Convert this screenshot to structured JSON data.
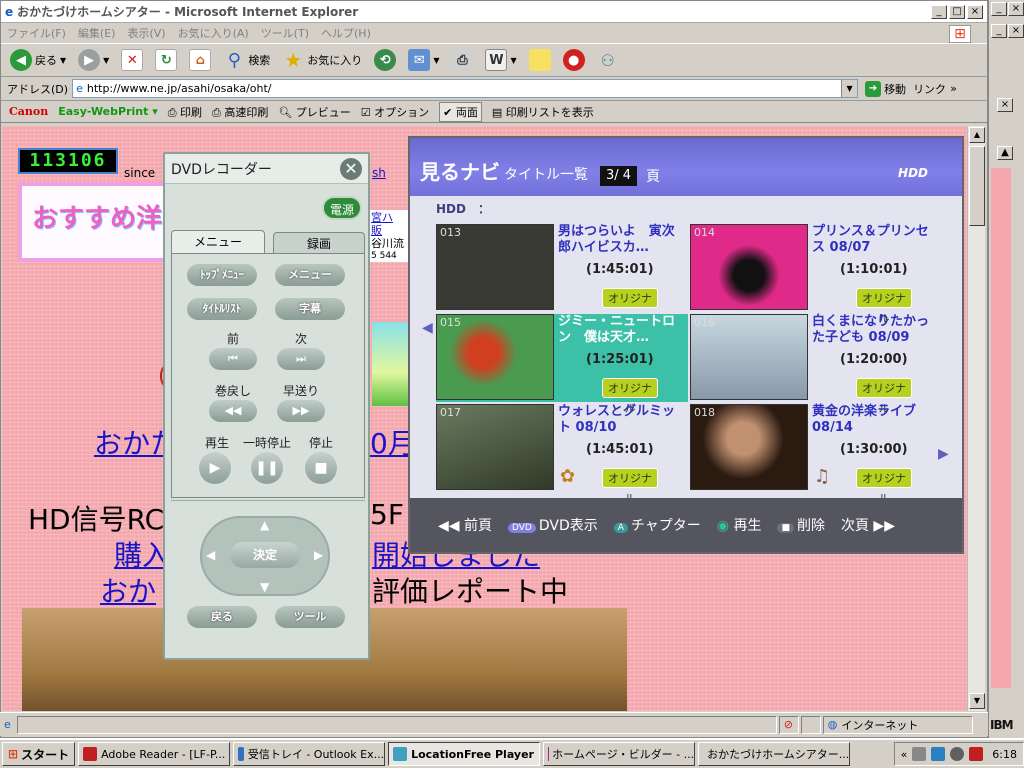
{
  "window": {
    "title": "おかたづけホームシアター - Microsoft Internet Explorer",
    "controls": [
      "_",
      "□",
      "×"
    ]
  },
  "menu": [
    "ファイル(F)",
    "編集(E)",
    "表示(V)",
    "お気に入り(A)",
    "ツール(T)",
    "ヘルプ(H)"
  ],
  "toolbar": {
    "back": "戻る",
    "search": "検索",
    "favorites": "お気に入り"
  },
  "address": {
    "label": "アドレス(D)",
    "url": "http://www.ne.jp/asahi/osaka/oht/",
    "go": "移動",
    "links": "リンク"
  },
  "printbar": {
    "canon": "Canon",
    "easy": "Easy-WebPrint",
    "print": "印刷",
    "fastprint": "高速印刷",
    "preview": "プレビュー",
    "option": "オプション",
    "both": "両面",
    "list": "印刷リストを表示"
  },
  "page": {
    "counter": "113106",
    "since": "since",
    "banner": "おすすめ洋",
    "side_text": [
      "sh",
      "宮ハ",
      "販",
      "谷川流",
      "5 544"
    ],
    "link_line1": "おかた",
    "link_line1_end": "0月",
    "hd_line": "HD信号RC",
    "hd_line_end": "5F",
    "link_buy": "購入",
    "link_buy_end": "開始しました",
    "review_prefix": "おか",
    "review_text": "評価レポート中"
  },
  "dvd": {
    "title": "DVDレコーダー",
    "power": "電源",
    "tabs": [
      "メニュー",
      "録画"
    ],
    "topmenu": "ﾄｯﾌﾟﾒﾆｭｰ",
    "menu": "メニュー",
    "titlelist": "ﾀｲﾄﾙﾘｽﾄ",
    "subtitle": "字幕",
    "prev": "前",
    "next": "次",
    "rewind": "巻戻し",
    "ffwd": "早送り",
    "play": "再生",
    "pause": "一時停止",
    "stop": "停止",
    "ok": "決定",
    "back": "戻る",
    "tool": "ツール"
  },
  "tv": {
    "logo": "見るナビ",
    "title": "タイトル一覧",
    "page": "3/ 4",
    "page_unit": "頁",
    "hdd": "HDD",
    "subheader": "HDD　：",
    "original": "オリジナル",
    "items": [
      {
        "num": "013",
        "title": "男はつらいよ　寅次郎ハイビスカ…",
        "dur": "(1:45:01)",
        "thumb": "#3a3a34"
      },
      {
        "num": "014",
        "title": "プリンス＆プリンセス 08/07",
        "dur": "(1:10:01)",
        "thumb": "#e02a8a"
      },
      {
        "num": "015",
        "title": "ジミー・ニュートロン　僕は天才…",
        "dur": "(1:25:01)",
        "thumb": "#4a9a50"
      },
      {
        "num": "016",
        "title": "白くまになりたかった子ども 08/09",
        "dur": "(1:20:00)",
        "thumb": "#c8d8e0"
      },
      {
        "num": "017",
        "title": "ウォレスとグルミット 08/10",
        "dur": "(1:45:01)",
        "thumb": "#506048"
      },
      {
        "num": "018",
        "title": "黄金の洋楽ライブ 08/14",
        "dur": "(1:30:00)",
        "thumb": "#3a2a20"
      }
    ],
    "footer": {
      "prev": "前頁",
      "dvd": "DVD表示",
      "chapter": "チャプター",
      "play": "再生",
      "delete": "削除",
      "next": "次頁"
    }
  },
  "status": {
    "zone": "インターネット"
  },
  "taskbar": {
    "start": "スタート",
    "tasks": [
      "Adobe Reader - [LF-P...",
      "受信トレイ - Outlook Ex...",
      "LocationFree Player",
      "ホームページ・ビルダー - ...",
      "おかたづけホームシアター..."
    ],
    "clock": "6:18"
  },
  "right": {
    "ibm": "IBM"
  }
}
